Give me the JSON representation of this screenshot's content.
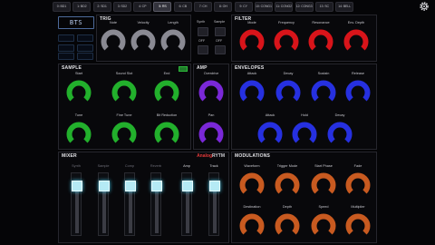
{
  "tracks": [
    "0: BD1",
    "1: BD2",
    "2: SD1",
    "3: SD2",
    "4: CP",
    "5: RS",
    "6: CB",
    "7: CH",
    "8: OH",
    "9: CY",
    "10: CONG1",
    "11: CONG2",
    "12: CONG3",
    "13: SC",
    "14: BELL"
  ],
  "active_track_index": 5,
  "logo": "BTS",
  "left_buttons": [
    "",
    "",
    "",
    "",
    "",
    ""
  ],
  "trig": {
    "title": "TRIG",
    "knobs": [
      "Note",
      "Velocity",
      "Length"
    ],
    "buttons": [
      "Synth",
      "Sample"
    ],
    "button_values": [
      "OFF",
      "OFF"
    ]
  },
  "filter": {
    "title": "FILTER",
    "knobs": [
      "Mode",
      "Frequency",
      "Resonance",
      "Env. Depth"
    ]
  },
  "sample": {
    "title": "SAMPLE",
    "knobs_row1": [
      "Start",
      "Sound Slot",
      "End"
    ],
    "knobs_row2": [
      "Tune",
      "Fine Tune",
      "Bit Reduction"
    ]
  },
  "amp": {
    "title": "AMP",
    "knobs": [
      "Overdrive",
      "Pan"
    ]
  },
  "envelopes": {
    "title": "ENVELOPES",
    "knobs_row1": [
      "Attack",
      "Decay",
      "Sustain",
      "Release"
    ],
    "knobs_row2": [
      "Attack",
      "Hold",
      "Decay"
    ]
  },
  "mixer": {
    "title": "MIXER",
    "channels": [
      "Synth",
      "Sample",
      "Comp",
      "Reverb",
      "Amp",
      "Track"
    ],
    "levels": [
      0.85,
      0.85,
      0.85,
      0.85,
      0.85,
      0.85
    ],
    "brand_a": "Analog",
    "brand_b": "RYTM"
  },
  "modulations": {
    "title": "MODULATIONS",
    "knobs_row1": [
      "Waveform",
      "Trigger Mode",
      "Start Phase",
      "Fade"
    ],
    "knobs_row2": [
      "Destination",
      "Depth",
      "Speed",
      "Multiplier"
    ]
  },
  "colors": {
    "trig": "#8a8a93",
    "filter": "#d8141a",
    "sample": "#22b02c",
    "amp": "#7a28d8",
    "envelopes": "#2630e0",
    "modulations": "#c85a20",
    "fader": "#b5eaf5"
  },
  "icons": {
    "settings": "gear-icon"
  }
}
